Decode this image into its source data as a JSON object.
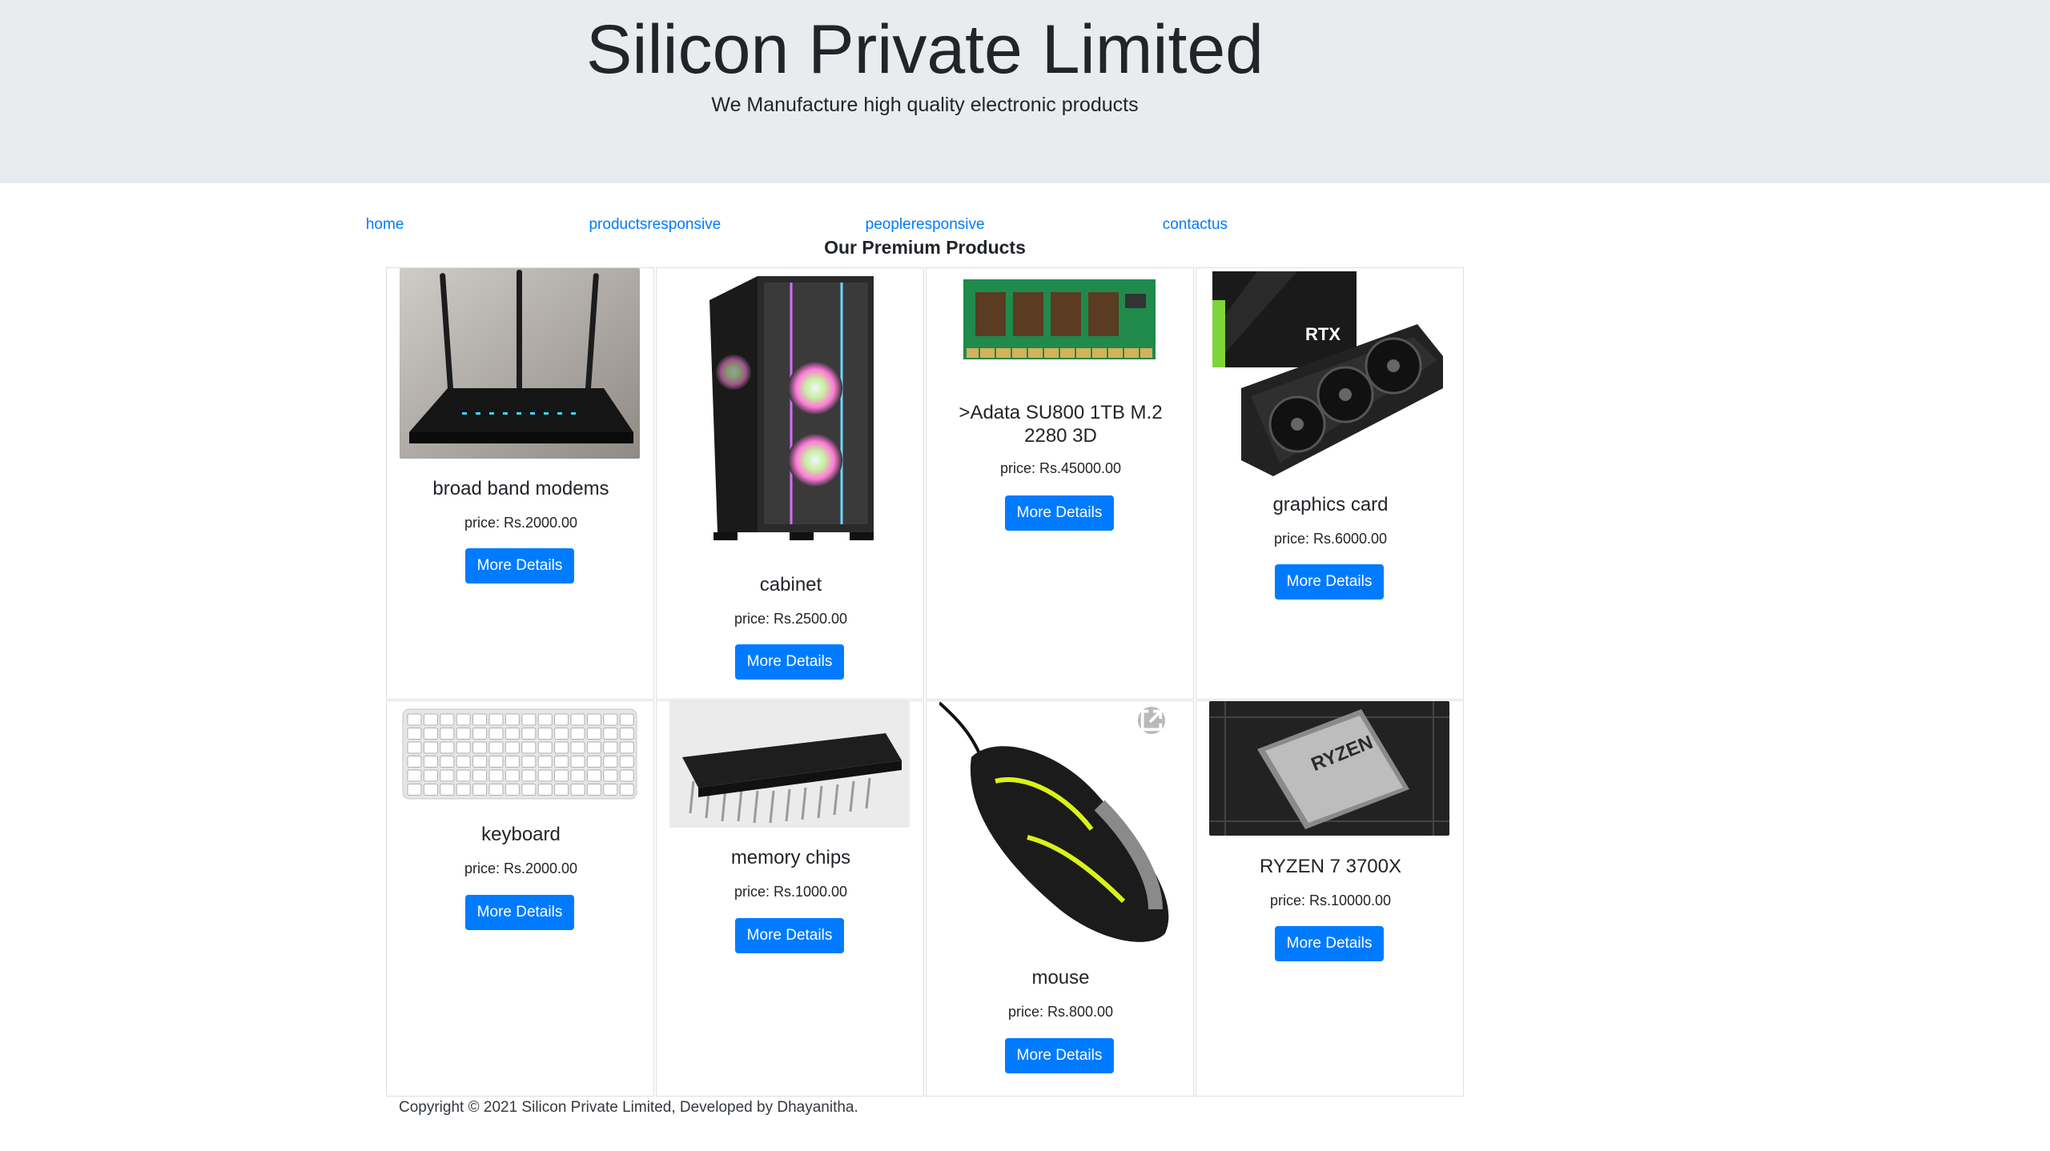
{
  "header": {
    "title": "Silicon Private Limited",
    "tagline": "We Manufacture high quality electronic products"
  },
  "nav": [
    {
      "label": "home"
    },
    {
      "label": "productsresponsive"
    },
    {
      "label": "peopleresponsive"
    },
    {
      "label": "contactus"
    }
  ],
  "section": {
    "title": "Our Premium Products"
  },
  "products": [
    {
      "name": "broad band modems",
      "price": "price: Rs.2000.00",
      "button": "More Details",
      "image": "router-image"
    },
    {
      "name": "cabinet",
      "price": "price: Rs.2500.00",
      "button": "More Details",
      "image": "pc-cabinet-image"
    },
    {
      "name": ">Adata SU800 1TB M.2 2280 3D",
      "price": "price: Rs.45000.00",
      "button": "More Details",
      "image": "ram-module-image"
    },
    {
      "name": "graphics card",
      "price": "price: Rs.6000.00",
      "button": "More Details",
      "image": "graphics-card-image",
      "box_text": "RTX"
    },
    {
      "name": "keyboard",
      "price": "price: Rs.2000.00",
      "button": "More Details",
      "image": "keyboard-image"
    },
    {
      "name": "memory chips",
      "price": "price: Rs.1000.00",
      "button": "More Details",
      "image": "memory-chip-image"
    },
    {
      "name": "mouse",
      "price": "price: Rs.800.00",
      "button": "More Details",
      "image": "gaming-mouse-image"
    },
    {
      "name": "RYZEN 7 3700X",
      "price": "price: Rs.10000.00",
      "button": "More Details",
      "image": "cpu-image",
      "chip_text": "RYZEN"
    }
  ],
  "footer": {
    "text": "Copyright © 2021 Silicon Private Limited, Developed by Dhayanitha."
  },
  "colors": {
    "accent": "#007bff",
    "jumbotron": "#e9ecef",
    "border": "#dfdfdf"
  }
}
